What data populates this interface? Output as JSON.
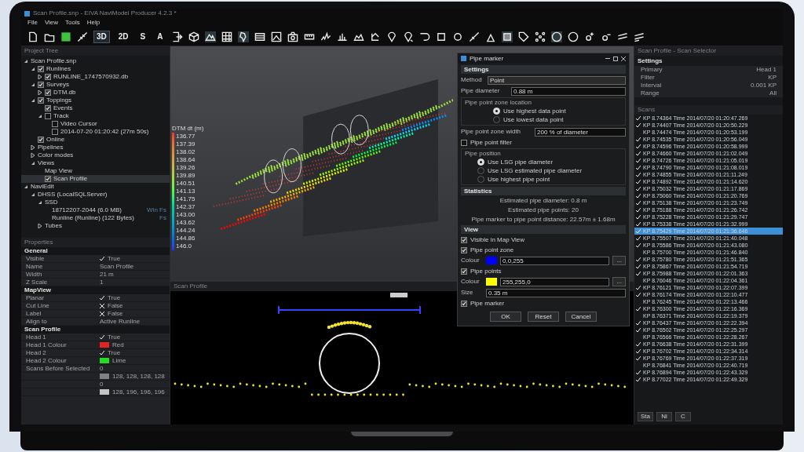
{
  "window": {
    "title": "Scan Profile.snp - EIVA NaviModel Producer 4.2.3 *"
  },
  "menu": [
    "File",
    "View",
    "Tools",
    "Help"
  ],
  "toolbar_text_buttons": [
    {
      "label": "3D",
      "selected": true
    },
    {
      "label": "2D",
      "selected": false
    },
    {
      "label": "S",
      "selected": false
    },
    {
      "label": "A",
      "selected": false
    }
  ],
  "project_tree": {
    "title": "Project Tree",
    "nodes": [
      {
        "label": "Scan Profile.snp",
        "kind": "plain",
        "expanded": true,
        "children": [
          {
            "label": "Runlines",
            "kind": "check",
            "checked": true,
            "expanded": true,
            "children": [
              {
                "label": "RUNLINE_1747570932.db",
                "kind": "check",
                "checked": true,
                "expanded": false
              }
            ]
          },
          {
            "label": "Surveys",
            "kind": "check",
            "checked": true,
            "expanded": true,
            "children": [
              {
                "label": "DTM.db",
                "kind": "check",
                "checked": true,
                "expanded": false
              }
            ]
          },
          {
            "label": "Toppings",
            "kind": "check",
            "checked": true,
            "expanded": true,
            "children": [
              {
                "label": "Events",
                "kind": "check",
                "checked": true
              },
              {
                "label": "Track",
                "kind": "check",
                "checked": false,
                "expanded": true,
                "children": [
                  {
                    "label": "Video Cursor",
                    "kind": "check",
                    "checked": false
                  },
                  {
                    "label": "2014-07-20 01:20:42 (27m 50s)",
                    "kind": "check",
                    "checked": false
                  }
                ]
              }
            ]
          },
          {
            "label": "Online",
            "kind": "check",
            "checked": true
          },
          {
            "label": "Pipelines",
            "kind": "plain",
            "expanded": false
          },
          {
            "label": "Color modes",
            "kind": "plain",
            "expanded": false
          },
          {
            "label": "Views",
            "kind": "plain",
            "expanded": true,
            "children": [
              {
                "label": "Map View",
                "kind": "plain"
              },
              {
                "label": "Scan Profile",
                "kind": "check",
                "checked": true,
                "selected": true
              }
            ]
          }
        ]
      },
      {
        "label": "NaviEdit",
        "kind": "plain",
        "expanded": true,
        "children": [
          {
            "label": "DHSS (LocalSQLServer)",
            "kind": "plain",
            "expanded": true,
            "children": [
              {
                "label": "SSD",
                "kind": "plain",
                "expanded": true,
                "children": [
                  {
                    "label": "18712207-2044 (6.0 MB)",
                    "kind": "plain",
                    "note": "Win Fs"
                  },
                  {
                    "label": "Runline (Runline) (122 Bytes)",
                    "kind": "plain",
                    "note": "Fs"
                  }
                ]
              },
              {
                "label": "Tubes",
                "kind": "plain",
                "expanded": false
              }
            ]
          }
        ]
      }
    ]
  },
  "properties": {
    "title": "Properties",
    "sections": [
      {
        "title": "General",
        "rows": [
          {
            "label": "Visible",
            "kind": "bool",
            "checked": true,
            "value": "True"
          },
          {
            "label": "Name",
            "kind": "text",
            "value": "Scan Profile"
          },
          {
            "label": "Width",
            "kind": "text",
            "value": "21 m"
          },
          {
            "label": "Z Scale",
            "kind": "text",
            "value": "1"
          }
        ]
      },
      {
        "title": "MapView",
        "rows": [
          {
            "label": "Planar",
            "kind": "bool",
            "checked": true,
            "value": "True"
          },
          {
            "label": "Cut Line",
            "kind": "bool",
            "checked": false,
            "value": "False"
          },
          {
            "label": "Label",
            "kind": "bool",
            "checked": false,
            "value": "False"
          },
          {
            "label": "Align to",
            "kind": "text",
            "value": "Active Runline"
          }
        ]
      },
      {
        "title": "Scan Profile",
        "rows": [
          {
            "label": "Head 1",
            "kind": "bool",
            "checked": true,
            "value": "True"
          },
          {
            "label": "Head 1 Colour",
            "kind": "color",
            "color": "#e02424",
            "value": "Red"
          },
          {
            "label": "Head 2",
            "kind": "bool",
            "checked": true,
            "value": "True"
          },
          {
            "label": "Head 2 Colour",
            "kind": "color",
            "color": "#22dd22",
            "value": "Lime"
          },
          {
            "label": "Scans Before Selected",
            "kind": "text",
            "value": "0"
          },
          {
            "kind": "color",
            "color": "#808080",
            "value": "128, 128, 128, 128"
          },
          {
            "kind": "text",
            "value": "0"
          },
          {
            "kind": "color",
            "color": "#c4c4c4",
            "value": "128, 196, 196, 196"
          }
        ]
      }
    ]
  },
  "map_legend": {
    "title": "DTM dt (m)",
    "values": [
      "136.77",
      "137.39",
      "138.02",
      "138.64",
      "139.26",
      "139.89",
      "140.51",
      "141.13",
      "141.75",
      "142.37",
      "143.00",
      "143.62",
      "144.24",
      "144.86",
      "146.0"
    ]
  },
  "scan_profile_panel": {
    "title": "Scan Profile"
  },
  "dialog": {
    "title": "Pipe marker",
    "settings": {
      "title": "Settings",
      "method_label": "Method",
      "method_value": "Point",
      "diameter_label": "Pipe diameter",
      "diameter_value": "0.88 m",
      "zone_location": {
        "title": "Pipe point zone location",
        "options": [
          {
            "label": "Use highest data point",
            "selected": true
          },
          {
            "label": "Use lowest data point",
            "selected": false
          }
        ]
      },
      "zone_width_label": "Pipe point zone width",
      "zone_width_value": "200 % of diameter",
      "filter": {
        "label": "Pipe point filter",
        "checked": false
      },
      "position": {
        "title": "Pipe position",
        "options": [
          {
            "label": "Use LSG pipe diameter",
            "selected": true
          },
          {
            "label": "Use LSG estimated pipe diameter",
            "selected": false
          },
          {
            "label": "Use highest pipe point",
            "selected": false
          }
        ]
      }
    },
    "statistics": {
      "title": "Statistics",
      "lines": [
        "Estimated pipe diameter: 0.8 m",
        "Estimated pipe points: 20",
        "Pipe marker to pipe point distance: 22.57m ± 1.68m"
      ]
    },
    "view": {
      "title": "View",
      "items": [
        {
          "kind": "check",
          "label": "Visible in Map View",
          "checked": true
        },
        {
          "kind": "check",
          "label": "Pipe point zone",
          "checked": true
        },
        {
          "kind": "color",
          "label": "Colour",
          "color": "#0000ff",
          "value": "0,0,255",
          "button": "..."
        },
        {
          "kind": "check",
          "label": "Pipe points",
          "checked": true
        },
        {
          "kind": "color",
          "label": "Colour",
          "color": "#ffff00",
          "value": "255,255,0",
          "button": "..."
        },
        {
          "kind": "field",
          "label": "Size",
          "value": "0.35 m"
        },
        {
          "kind": "check",
          "label": "Pipe marker",
          "checked": true
        }
      ]
    },
    "buttons": [
      "OK",
      "Reset",
      "Cancel"
    ]
  },
  "scan_selector": {
    "title": "Scan Profile - Scan Selector",
    "settings_title": "Settings",
    "settings": [
      {
        "label": "Primary",
        "value": "Head 1"
      },
      {
        "label": "Filter",
        "value": "KP"
      },
      {
        "label": "Interval",
        "value": "0.001 KP"
      },
      {
        "label": "Range",
        "value": "All"
      }
    ],
    "scans_title": "Scans",
    "scans": [
      {
        "text": "KP 8.74364 Time 2014/07/20 01:20:47.269",
        "checked": true,
        "selected": false
      },
      {
        "text": "KP 8.74407 Time 2014/07/20 01:20:50.229",
        "checked": true,
        "selected": false
      },
      {
        "text": "KP 8.74474 Time 2014/07/20 01:20:53.199",
        "checked": false,
        "selected": false
      },
      {
        "text": "KP 8.74535 Time 2014/07/20 01:20:56.049",
        "checked": true,
        "selected": false
      },
      {
        "text": "KP 8.74596 Time 2014/07/20 01:20:58.999",
        "checked": true,
        "selected": false
      },
      {
        "text": "KP 8.74660 Time 2014/07/20 01:21:02.049",
        "checked": true,
        "selected": false
      },
      {
        "text": "KP 8.74726 Time 2014/07/20 01:21:05.019",
        "checked": true,
        "selected": false
      },
      {
        "text": "KP 8.74790 Time 2014/07/20 01:21:08.019",
        "checked": true,
        "selected": false
      },
      {
        "text": "KP 8.74855 Time 2014/07/20 01:21:11.249",
        "checked": true,
        "selected": false
      },
      {
        "text": "KP 8.74892 Time 2014/07/20 01:21:14.620",
        "checked": true,
        "selected": false
      },
      {
        "text": "KP 8.75032 Time 2014/07/20 01:21:17.869",
        "checked": true,
        "selected": false
      },
      {
        "text": "KP 8.75060 Time 2014/07/20 01:21:20.769",
        "checked": true,
        "selected": false
      },
      {
        "text": "KP 8.75138 Time 2014/07/20 01:21:23.749",
        "checked": true,
        "selected": false
      },
      {
        "text": "KP 8.75188 Time 2014/07/20 01:21:26.742",
        "checked": true,
        "selected": false
      },
      {
        "text": "KP 8.75228 Time 2014/07/20 01:21:29.747",
        "checked": true,
        "selected": false
      },
      {
        "text": "KP 8.75338 Time 2014/07/20 01:21:32.999",
        "checked": true,
        "selected": false
      },
      {
        "text": "KP 8.75429 Time 2014/07/20 01:21:36.646",
        "checked": true,
        "selected": true
      },
      {
        "text": "KP 8.75507 Time 2014/07/20 01:21:40.048",
        "checked": true,
        "selected": false
      },
      {
        "text": "KP 8.75586 Time 2014/07/20 01:21:43.080",
        "checked": true,
        "selected": false
      },
      {
        "text": "KP 8.75700 Time 2014/07/20 01:21:46.840",
        "checked": false,
        "selected": false
      },
      {
        "text": "KP 8.75780 Time 2014/07/20 01:21:51.365",
        "checked": true,
        "selected": false
      },
      {
        "text": "KP 8.75867 Time 2014/07/20 01:21:54.719",
        "checked": true,
        "selected": false
      },
      {
        "text": "KP 8.75988 Time 2014/07/20 01:22:01.363",
        "checked": true,
        "selected": false
      },
      {
        "text": "KP 8.76046 Time 2014/07/20 01:22:04.361",
        "checked": false,
        "selected": false
      },
      {
        "text": "KP 8.76121 Time 2014/07/20 01:22:07.399",
        "checked": true,
        "selected": false
      },
      {
        "text": "KP 8.76174 Time 2014/07/20 01:22:10.477",
        "checked": true,
        "selected": false
      },
      {
        "text": "KP 8.76245 Time 2014/07/20 01:22:13.466",
        "checked": false,
        "selected": false
      },
      {
        "text": "KP 8.76300 Time 2014/07/20 01:22:16.369",
        "checked": true,
        "selected": false
      },
      {
        "text": "KP 8.76371 Time 2014/07/20 01:22:19.379",
        "checked": false,
        "selected": false
      },
      {
        "text": "KP 8.76437 Time 2014/07/20 01:22:22.394",
        "checked": true,
        "selected": false
      },
      {
        "text": "KP 8.76502 Time 2014/07/20 01:22:25.297",
        "checked": true,
        "selected": false
      },
      {
        "text": "KP 8.76566 Time 2014/07/20 01:22:28.267",
        "checked": false,
        "selected": false
      },
      {
        "text": "KP 8.76638 Time 2014/07/20 01:22:31.399",
        "checked": true,
        "selected": false
      },
      {
        "text": "KP 8.76702 Time 2014/07/20 01:22:34.314",
        "checked": true,
        "selected": false
      },
      {
        "text": "KP 8.76769 Time 2014/07/20 01:22:37.319",
        "checked": true,
        "selected": false
      },
      {
        "text": "KP 8.76841 Time 2014/07/20 01:22:40.719",
        "checked": false,
        "selected": false
      },
      {
        "text": "KP 8.76894 Time 2014/07/20 01:22:43.329",
        "checked": true,
        "selected": false
      },
      {
        "text": "KP 8.77022 Time 2014/07/20 01:22:49.329",
        "checked": true,
        "selected": false
      }
    ],
    "buttons": [
      "Sta",
      "Ni",
      "C"
    ]
  }
}
